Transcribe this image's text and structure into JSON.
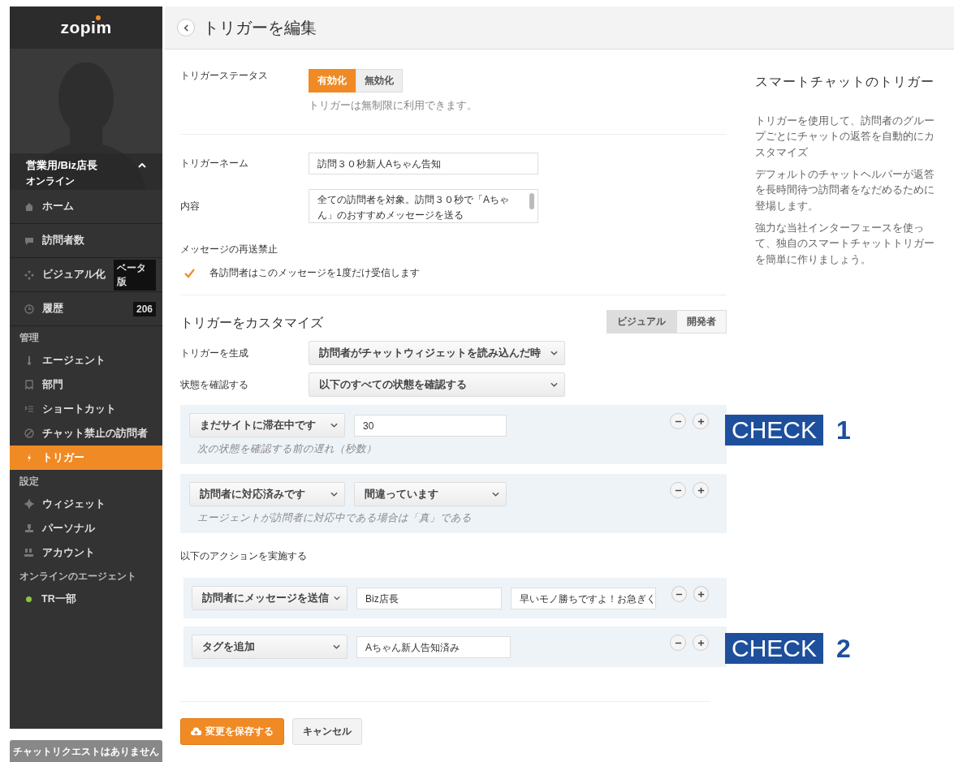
{
  "sidebar": {
    "logo": "zopim",
    "profile": {
      "name": "営業用/Biz店長",
      "status": "オンライン",
      "expanded": true
    },
    "nav": [
      {
        "label": "ホーム",
        "selected": false
      },
      {
        "label": "訪問者数",
        "selected": false
      },
      {
        "label": "ビジュアル化",
        "badge": "ベータ版",
        "selected": false
      },
      {
        "label": "履歴",
        "badge": "206",
        "selected": false
      }
    ],
    "sections": [
      {
        "heading": "管理",
        "items": [
          {
            "label": "エージェント",
            "selected": false
          },
          {
            "label": "部門",
            "selected": false
          },
          {
            "label": "ショートカット",
            "selected": false
          },
          {
            "label": "チャット禁止の訪問者",
            "selected": false
          },
          {
            "label": "トリガー",
            "selected": true
          }
        ]
      },
      {
        "heading": "設定",
        "items": [
          {
            "label": "ウィジェット",
            "selected": false
          },
          {
            "label": "パーソナル",
            "selected": false
          },
          {
            "label": "アカウント",
            "selected": false
          }
        ]
      }
    ],
    "online_agents": {
      "heading": "オンラインのエージェント",
      "agents": [
        {
          "name": "TR一部",
          "color": "#8cc63f"
        }
      ]
    },
    "footer": "チャットリクエストはありません"
  },
  "header": {
    "title": "トリガーを編集"
  },
  "form": {
    "status": {
      "label": "トリガーステータス",
      "options": [
        {
          "label": "有効化",
          "selected": true
        },
        {
          "label": "無効化",
          "selected": false
        }
      ],
      "hint": "トリガーは無制限に利用できます。"
    },
    "name": {
      "label": "トリガーネーム",
      "value": "訪問３０秒新人Aちゃん告知"
    },
    "content": {
      "label": "内容",
      "value": "全ての訪問者を対象。訪問３０秒で「Aちゃん」のおすすめメッセージを送る"
    },
    "resend": {
      "label": "メッセージの再送禁止",
      "checkbox": {
        "label": "各訪問者はこのメッセージを1度だけ受信します",
        "checked": true
      }
    },
    "customize": {
      "title": "トリガーをカスタマイズ",
      "modes": [
        {
          "label": "ビジュアル",
          "selected": true
        },
        {
          "label": "開発者",
          "selected": false
        }
      ]
    },
    "run_on": {
      "label": "トリガーを生成",
      "value": "訪問者がチャットウィジェットを読み込んだ時"
    },
    "check_conditions": {
      "label": "状態を確認する",
      "value": "以下のすべての状態を確認する"
    },
    "conditions": [
      {
        "field": "まだサイトに滞在中です",
        "value": "30",
        "kind": "input",
        "hint": "次の状態を確認する前の遅れ（秒数）",
        "annotation": {
          "label": "CHECK",
          "number": "1"
        }
      },
      {
        "field": "訪問者に対応済みです",
        "value": "間違っています",
        "kind": "select",
        "hint": "エージェントが訪問者に対応中である場合は「真」である"
      }
    ],
    "actions_label": "以下のアクションを実施する",
    "actions": [
      {
        "type": "訪問者にメッセージを送信",
        "values": [
          "Biz店長",
          "早いモノ勝ちですよ！お急ぎく"
        ]
      },
      {
        "type": "タグを追加",
        "values": [
          "Aちゃん新人告知済み"
        ],
        "annotation": {
          "label": "CHECK",
          "number": "2"
        }
      }
    ],
    "buttons": {
      "save": "変更を保存する",
      "cancel": "キャンセル"
    }
  },
  "help": {
    "title": "スマートチャットのトリガー",
    "paragraphs": [
      "トリガーを使用して、訪問者のグループごとにチャットの返答を自動的にカスタマイズ",
      "デフォルトのチャットヘルパーが返答を長時間待つ訪問者をなだめるために登場します。",
      "強力な当社インターフェースを使って、独自のスマートチャットトリガーを簡単に作りましょう。"
    ]
  }
}
